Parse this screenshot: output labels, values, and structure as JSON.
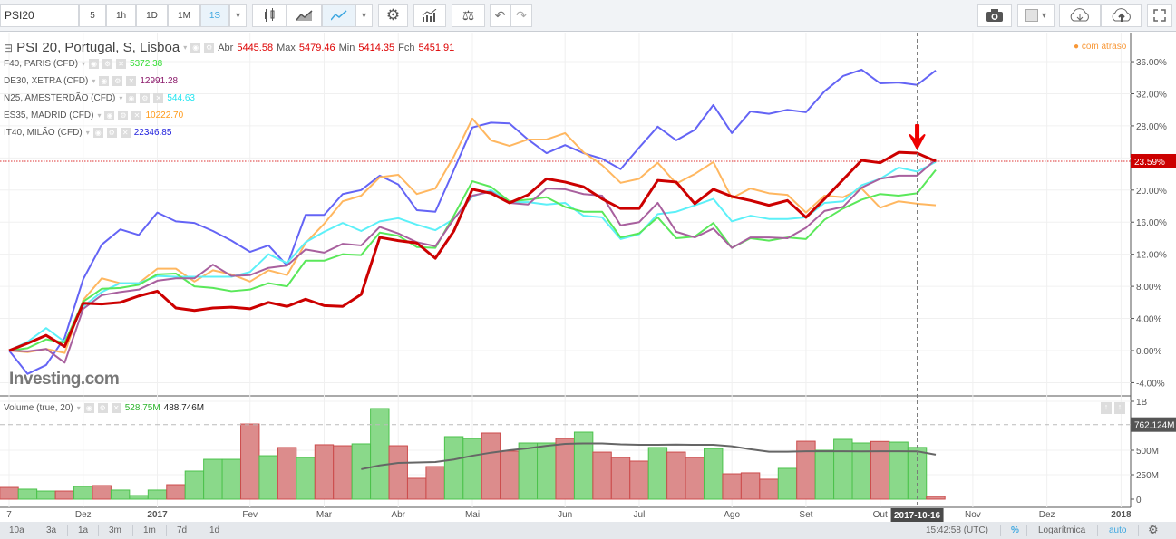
{
  "toolbar": {
    "symbol": "PSI20",
    "intervals": [
      "5",
      "1h",
      "1D",
      "1M",
      "1S"
    ],
    "active_interval": "1S"
  },
  "legend": {
    "main": {
      "name": "PSI 20, Portugal, S, Lisboa",
      "open_label": "Abr",
      "open": "5445.58",
      "high_label": "Max",
      "high": "5479.46",
      "low_label": "Min",
      "low": "5414.35",
      "close_label": "Fch",
      "close": "5451.91"
    },
    "compare": [
      {
        "name": "F40, PARIS (CFD)",
        "value": "5372.38",
        "color": "#33dd33"
      },
      {
        "name": "DE30, XETRA (CFD)",
        "value": "12991.28",
        "color": "#8b1a6b"
      },
      {
        "name": "N25, AMESTERDÃO (CFD)",
        "value": "544.63",
        "color": "#22e5f0"
      },
      {
        "name": "ES35, MADRID (CFD)",
        "value": "10222.70",
        "color": "#ff9a1a"
      },
      {
        "name": "IT40, MILÃO (CFD)",
        "value": "22346.85",
        "color": "#2222dd"
      }
    ],
    "volume": {
      "name": "Volume (true, 20)",
      "value": "528.75M",
      "ma": "488.746M"
    }
  },
  "delay_notice": "com atraso",
  "logo": "Investing.com",
  "bottom": {
    "ranges": [
      "10a",
      "3a",
      "1a",
      "3m",
      "1m",
      "7d",
      "1d"
    ],
    "time": "15:42:58 (UTC)",
    "percent": "%",
    "log": "Logarítmica",
    "auto": "auto"
  },
  "crosshair_date": "2017-10-16",
  "chart_data": {
    "type": "line",
    "y_unit": "%",
    "ylim": [
      -6,
      40
    ],
    "y_ticks": [
      "36.00%",
      "32.00%",
      "28.00%",
      "20.00%",
      "16.00%",
      "12.00%",
      "8.00%",
      "4.00%",
      "0.00%",
      "-4.00%"
    ],
    "y_tick_values": [
      36,
      32,
      28,
      20,
      16,
      12,
      8,
      4,
      0,
      -4
    ],
    "last_value_label": "23.59%",
    "last_value": 23.59,
    "x_start": "2016-11-07",
    "x_step_days": 7,
    "x_ticks": [
      {
        "label": "7",
        "date": "2016-11-07"
      },
      {
        "label": "Dez",
        "date": "2016-12-05"
      },
      {
        "label": "2017",
        "date": "2017-01-02",
        "bold": true
      },
      {
        "label": "Fev",
        "date": "2017-02-06"
      },
      {
        "label": "Mar",
        "date": "2017-03-06"
      },
      {
        "label": "Abr",
        "date": "2017-04-03"
      },
      {
        "label": "Mai",
        "date": "2017-05-01"
      },
      {
        "label": "Jun",
        "date": "2017-06-05"
      },
      {
        "label": "Jul",
        "date": "2017-07-03"
      },
      {
        "label": "Ago",
        "date": "2017-08-07"
      },
      {
        "label": "Set",
        "date": "2017-09-04"
      },
      {
        "label": "Out",
        "date": "2017-10-02"
      },
      {
        "label": "Nov",
        "date": "2017-11-06"
      },
      {
        "label": "Dez",
        "date": "2017-12-04"
      },
      {
        "label": "2018",
        "date": "2018-01-01",
        "bold": true
      }
    ],
    "series": [
      {
        "name": "IT40, MILÃO (CFD)",
        "color": "#6464f5",
        "values": [
          0,
          -2.9,
          -1.8,
          1.6,
          8.9,
          13.2,
          15.1,
          14.4,
          17.2,
          16.1,
          15.9,
          14.9,
          13.7,
          12.3,
          13.1,
          10.6,
          16.9,
          16.9,
          19.5,
          20.0,
          21.8,
          20.7,
          17.5,
          17.3,
          22.5,
          27.8,
          28.4,
          28.3,
          26.3,
          24.6,
          25.6,
          24.6,
          23.9,
          22.6,
          25.3,
          27.9,
          26.2,
          27.5,
          30.6,
          27.1,
          29.8,
          29.5,
          30.0,
          29.7,
          32.3,
          34.2,
          35.0,
          33.3,
          33.4,
          33.1,
          34.9
        ]
      },
      {
        "name": "ES35, MADRID (CFD)",
        "color": "#ffb760",
        "values": [
          0,
          -0.2,
          0.2,
          -0.3,
          6.3,
          9.0,
          8.4,
          8.4,
          10.2,
          10.2,
          8.6,
          10.0,
          9.5,
          8.6,
          10.0,
          9.4,
          13.4,
          15.8,
          18.6,
          19.3,
          21.6,
          21.9,
          19.5,
          20.2,
          24.2,
          28.9,
          26.2,
          25.5,
          26.3,
          26.3,
          27.1,
          24.7,
          23.1,
          20.9,
          21.4,
          23.4,
          20.8,
          22.0,
          23.5,
          19.0,
          20.2,
          19.6,
          19.4,
          17.2,
          19.3,
          19.1,
          20.2,
          17.8,
          18.6,
          18.3,
          18.1
        ]
      },
      {
        "name": "N25, AMESTERDÃO (CFD)",
        "color": "#5cf0f8",
        "values": [
          0,
          1.1,
          2.8,
          1.1,
          5.5,
          7.3,
          8.4,
          8.4,
          9.3,
          9.2,
          9.2,
          9.2,
          9.2,
          9.8,
          12.0,
          10.9,
          13.5,
          14.8,
          15.9,
          14.9,
          16.1,
          16.5,
          15.7,
          15.0,
          16.4,
          19.2,
          20.0,
          18.5,
          18.5,
          18.2,
          18.4,
          16.8,
          16.6,
          13.9,
          14.5,
          17.0,
          17.3,
          18.1,
          18.9,
          16.1,
          16.8,
          16.4,
          16.4,
          16.6,
          18.4,
          18.6,
          20.6,
          21.4,
          22.8,
          22.3,
          23.5
        ]
      },
      {
        "name": "F40, PARIS (CFD)",
        "color": "#5ae85a",
        "values": [
          0,
          0.3,
          1.4,
          1.0,
          6.1,
          7.7,
          7.8,
          8.2,
          9.5,
          9.6,
          8.0,
          7.8,
          7.4,
          7.6,
          8.4,
          8.0,
          11.2,
          11.2,
          12.0,
          11.9,
          14.7,
          14.3,
          12.9,
          12.8,
          16.8,
          21.1,
          20.4,
          18.6,
          18.8,
          19.1,
          17.9,
          17.3,
          17.3,
          14.1,
          14.6,
          16.6,
          14.0,
          14.2,
          15.9,
          12.8,
          14.0,
          13.7,
          14.1,
          13.9,
          16.3,
          17.7,
          18.8,
          19.5,
          19.3,
          19.6,
          22.5
        ]
      },
      {
        "name": "DE30, XETRA (CFD)",
        "color": "#a8609e",
        "values": [
          0,
          -0.1,
          0.2,
          -1.5,
          5.2,
          6.9,
          7.3,
          7.6,
          8.7,
          9.0,
          9.0,
          10.7,
          9.3,
          9.4,
          10.3,
          10.6,
          12.6,
          12.2,
          13.3,
          13.1,
          15.4,
          14.6,
          13.5,
          13.0,
          16.4,
          19.3,
          19.8,
          18.4,
          18.2,
          20.2,
          20.1,
          19.5,
          19.3,
          15.6,
          16.0,
          18.4,
          14.8,
          14.1,
          15.2,
          12.8,
          14.1,
          14.1,
          14.0,
          15.3,
          17.4,
          17.9,
          20.3,
          21.4,
          21.8,
          21.8,
          23.8
        ]
      },
      {
        "name": "PSI 20, Portugal, S, Lisboa",
        "color": "#cc0000",
        "values": [
          0,
          0.9,
          1.9,
          0.5,
          5.9,
          5.8,
          6.0,
          6.8,
          7.4,
          5.3,
          5.0,
          5.3,
          5.4,
          5.2,
          6.0,
          5.5,
          6.4,
          5.6,
          5.5,
          7.0,
          14.1,
          13.7,
          13.4,
          11.5,
          14.9,
          20.1,
          19.6,
          18.4,
          19.4,
          21.4,
          21.0,
          20.4,
          18.9,
          17.7,
          17.7,
          21.2,
          21.0,
          18.3,
          20.1,
          19.2,
          18.7,
          18.1,
          18.7,
          16.6,
          18.9,
          21.3,
          23.7,
          23.4,
          24.7,
          24.6,
          23.6
        ]
      }
    ],
    "volume": {
      "unit": "M",
      "ylim": [
        0,
        1100
      ],
      "y_ticks": [
        "1B",
        "500M",
        "250M",
        "0"
      ],
      "y_tick_values": [
        1000,
        500,
        250,
        0
      ],
      "max_label": "762.124M",
      "max_value": 762.124,
      "values": [
        120,
        102,
        83,
        83,
        130,
        139,
        93,
        37,
        93,
        148,
        287,
        407,
        407,
        768,
        444,
        528,
        426,
        556,
        546,
        565,
        926,
        546,
        213,
        333,
        639,
        620,
        676,
        491,
        574,
        574,
        620,
        685,
        481,
        426,
        389,
        528,
        481,
        426,
        518,
        259,
        269,
        204,
        315,
        592,
        500,
        611,
        574,
        590,
        583,
        529,
        28
      ],
      "direction": [
        "down",
        "up",
        "up",
        "down",
        "up",
        "down",
        "up",
        "up",
        "up",
        "down",
        "up",
        "up",
        "up",
        "down",
        "up",
        "down",
        "up",
        "down",
        "down",
        "up",
        "up",
        "down",
        "down",
        "down",
        "up",
        "up",
        "down",
        "down",
        "up",
        "up",
        "down",
        "up",
        "down",
        "down",
        "down",
        "up",
        "down",
        "down",
        "up",
        "down",
        "down",
        "down",
        "up",
        "down",
        "up",
        "up",
        "up",
        "down",
        "up",
        "up",
        "down"
      ],
      "ma_start_index": 19,
      "ma": [
        306,
        345,
        370,
        375,
        380,
        405,
        444,
        475,
        500,
        520,
        545,
        565,
        570,
        570,
        560,
        555,
        555,
        558,
        555,
        555,
        540,
        510,
        485,
        485,
        490,
        490,
        490,
        488,
        490,
        490,
        489,
        455
      ]
    }
  }
}
